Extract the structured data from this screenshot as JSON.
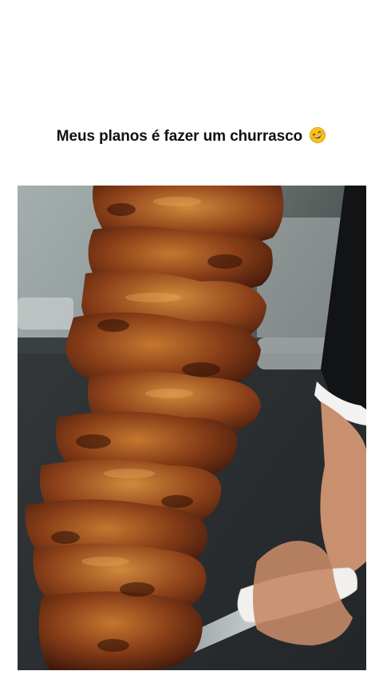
{
  "post": {
    "caption_text": "Meus planos é fazer um churrasco",
    "caption_emoji": "rolling-on-the-floor-laughing-emoji-icon"
  },
  "media": {
    "type": "photo",
    "subject": "skewered grilled picanha churrasco being sliced with a knife"
  }
}
